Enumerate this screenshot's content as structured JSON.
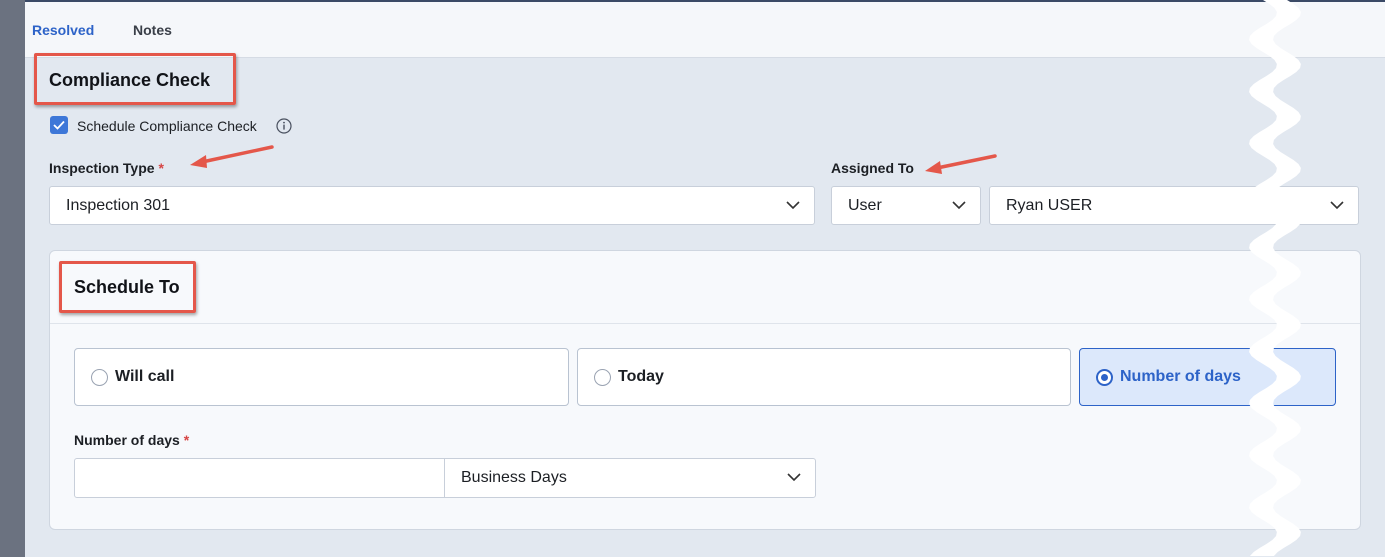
{
  "tabs": [
    {
      "label": "Resolved",
      "active": true
    },
    {
      "label": "Notes",
      "active": false
    }
  ],
  "compliance": {
    "title": "Compliance Check",
    "schedule_checkbox_label": "Schedule Compliance Check",
    "schedule_checked": true,
    "inspection_type_label": "Inspection Type",
    "required_mark": "*",
    "inspection_type_value": "Inspection 301",
    "assigned_to_label": "Assigned To",
    "assigned_kind_value": "User",
    "assigned_user_value": "Ryan USER"
  },
  "schedule_to": {
    "title": "Schedule To",
    "options": [
      {
        "label": "Will call",
        "selected": false
      },
      {
        "label": "Today",
        "selected": false
      },
      {
        "label": "Number of days",
        "selected": true
      }
    ],
    "days_label": "Number of days",
    "required_mark": "*",
    "days_value": "",
    "days_unit_value": "Business Days"
  },
  "icons": {
    "checkbox": "check-icon",
    "info": "info-icon",
    "dropdown": "chevron-down-icon"
  },
  "colors": {
    "accent": "#2d63c8",
    "annotation": "#e4574a",
    "required": "#d64545"
  }
}
